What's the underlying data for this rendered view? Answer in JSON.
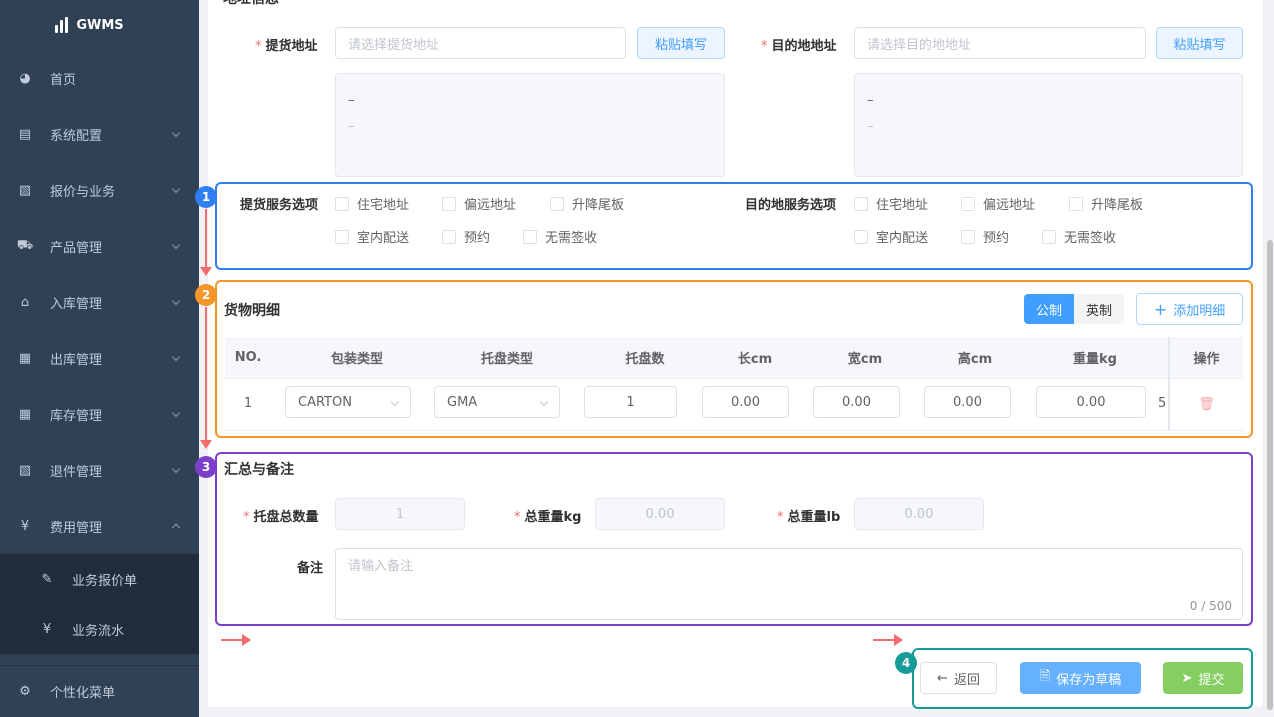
{
  "sidebar": {
    "logo": "GWMS",
    "items": [
      {
        "label": "首页",
        "icon": "dashboard-icon",
        "glyph": "◕",
        "expandable": false
      },
      {
        "label": "系统配置",
        "icon": "system-config-icon",
        "glyph": "▤",
        "expandable": true
      },
      {
        "label": "报价与业务",
        "icon": "quote-icon",
        "glyph": "▧",
        "expandable": true
      },
      {
        "label": "产品管理",
        "icon": "cart-icon",
        "glyph": "⛟",
        "expandable": true
      },
      {
        "label": "入库管理",
        "icon": "home-icon",
        "glyph": "⌂",
        "expandable": true
      },
      {
        "label": "出库管理",
        "icon": "grid-icon",
        "glyph": "▦",
        "expandable": true
      },
      {
        "label": "库存管理",
        "icon": "table-icon",
        "glyph": "▦",
        "expandable": true
      },
      {
        "label": "退件管理",
        "icon": "return-icon",
        "glyph": "▧",
        "expandable": true
      },
      {
        "label": "费用管理",
        "icon": "yen-icon",
        "glyph": "¥",
        "expandable": true,
        "open": true
      }
    ],
    "submenu": [
      {
        "label": "业务报价单",
        "icon": "edit-icon",
        "glyph": "✎"
      },
      {
        "label": "业务流水",
        "icon": "yen-icon",
        "glyph": "¥"
      }
    ],
    "bottom": {
      "label": "个性化菜单",
      "icon": "gear-icon",
      "glyph": "⚙"
    }
  },
  "address": {
    "section_title": "地址信息",
    "pickup_label": "提货地址",
    "pickup_placeholder": "请选择提货地址",
    "paste_label": "粘贴填写",
    "dest_label": "目的地地址",
    "dest_placeholder": "请选择目的地地址",
    "pickup_box_line1": "–",
    "pickup_box_line2": "–",
    "dest_box_line1": "–",
    "dest_box_line2": "–"
  },
  "services": {
    "pickup_label": "提货服务选项",
    "dest_label": "目的地服务选项",
    "options_row1": [
      "住宅地址",
      "偏远地址",
      "升降尾板"
    ],
    "options_row2": [
      "室内配送",
      "预约",
      "无需签收"
    ]
  },
  "cargo": {
    "title": "货物明细",
    "unit_metric": "公制",
    "unit_imperial": "英制",
    "add_label": "添加明细",
    "columns": [
      "NO.",
      "包装类型",
      "托盘类型",
      "托盘数",
      "长cm",
      "宽cm",
      "高cm",
      "重量kg",
      "操作"
    ],
    "rows": [
      {
        "no": "1",
        "package": "CARTON",
        "pallet": "GMA",
        "pallets": "1",
        "length": "0.00",
        "width": "0.00",
        "height": "0.00",
        "weight": "0.00",
        "extra": "5"
      }
    ]
  },
  "summary": {
    "title": "汇总与备注",
    "pallet_total_label": "托盘总数量",
    "pallet_total": "1",
    "weight_kg_label": "总重量kg",
    "weight_kg": "0.00",
    "weight_lb_label": "总重量lb",
    "weight_lb": "0.00",
    "remark_label": "备注",
    "remark_placeholder": "请输入备注",
    "remark_count": "0 / 500"
  },
  "actions": {
    "back": "返回",
    "save_draft": "保存为草稿",
    "submit": "提交"
  },
  "annotations": {
    "badge1": "1",
    "badge2": "2",
    "badge3": "3",
    "badge4": "4",
    "color1": "#2f7ff0",
    "color2": "#f5962a",
    "color3": "#7c3fc9",
    "color4": "#169c98",
    "arrow": "#f56c6c"
  }
}
